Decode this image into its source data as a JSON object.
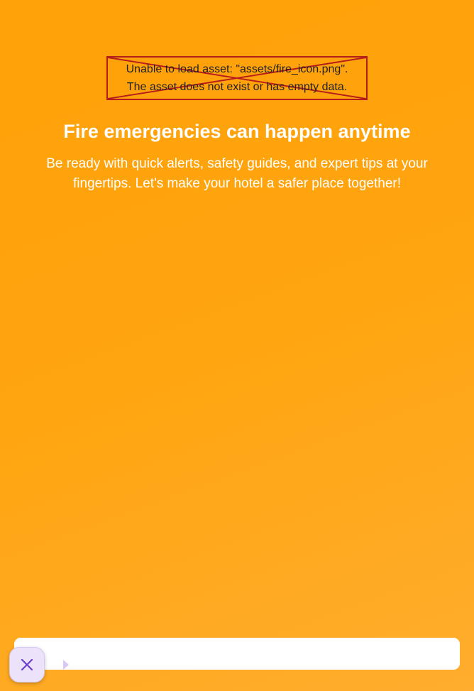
{
  "asset_error": {
    "line1": "Unable to load asset: \"assets/fire_icon.png\".",
    "line2": "The asset does not exist or has empty data.",
    "icon": "broken-image-cross"
  },
  "onboarding": {
    "title": "Fire emergencies can happen anytime",
    "description": "Be ready with quick alerts, safety guides, and expert tips at your fingertips. Let's make your hotel a safer place together!"
  },
  "bottom_bar": {
    "close_icon": "close-icon",
    "arrow_icon": "play-arrow-icon"
  },
  "colors": {
    "background_start": "#ffa108",
    "background_end": "#ffad2e",
    "error_border": "#b71c1c",
    "fab_background": "#ece3fb",
    "fab_icon": "#6a40c8",
    "text": "#ffffff"
  }
}
